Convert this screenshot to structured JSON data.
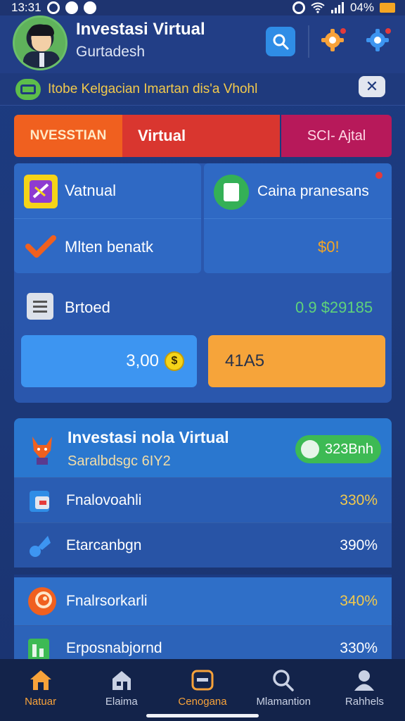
{
  "status_bar": {
    "time": "13:31",
    "battery": "04%"
  },
  "header": {
    "title": "Investasi Virtual",
    "subtitle": "Gurtadesh"
  },
  "notice": {
    "text": "Itobe Kelgacian Imartan dis'a Vhohl",
    "close_label": "✕"
  },
  "tabs": [
    {
      "label": "NVESSTIAN"
    },
    {
      "label": "Virtual"
    },
    {
      "label": "SCI- Ajtal"
    }
  ],
  "dashboard": {
    "cell1_label": "Vatnual",
    "cell2_label": "Caina pranesans",
    "row2_label": "Mlten benatk",
    "row2_value": "$0!",
    "row3_label": "Brtoed",
    "row3_value": "0.9 $29185",
    "pill_blue_value": "3,00",
    "pill_blue_coin": "$",
    "pill_orange_value": "41A5",
    "colors": {
      "value_orange": "#f5a623",
      "value_green": "#5fd37a"
    }
  },
  "investments": {
    "title": "Investasi nola Virtual",
    "subtitle": "Saralbdsgc 6IY2",
    "badge": "323Bnh",
    "items": [
      {
        "label": "Fnalovoahli",
        "value": "330%",
        "icon": "wallet-icon",
        "value_color": "#f2c94c"
      },
      {
        "label": "Etarcanbgn",
        "value": "390%",
        "icon": "rocket-icon",
        "value_color": "#ffffff"
      },
      {
        "label": "Fnalrsorkarli",
        "value": "340%",
        "icon": "target-icon",
        "value_color": "#f2c94c"
      },
      {
        "label": "Erposnabjornd",
        "value": "330%",
        "icon": "chart-icon",
        "value_color": "#ffffff"
      }
    ]
  },
  "bottom_nav": [
    {
      "label": "Natuar",
      "icon": "home-icon",
      "active": true
    },
    {
      "label": "Elaima",
      "icon": "market-icon",
      "active": false
    },
    {
      "label": "Cenogana",
      "icon": "portfolio-icon",
      "active": false
    },
    {
      "label": "Mlamantion",
      "icon": "search-icon",
      "active": false
    },
    {
      "label": "Rahhels",
      "icon": "profile-icon",
      "active": false
    }
  ]
}
